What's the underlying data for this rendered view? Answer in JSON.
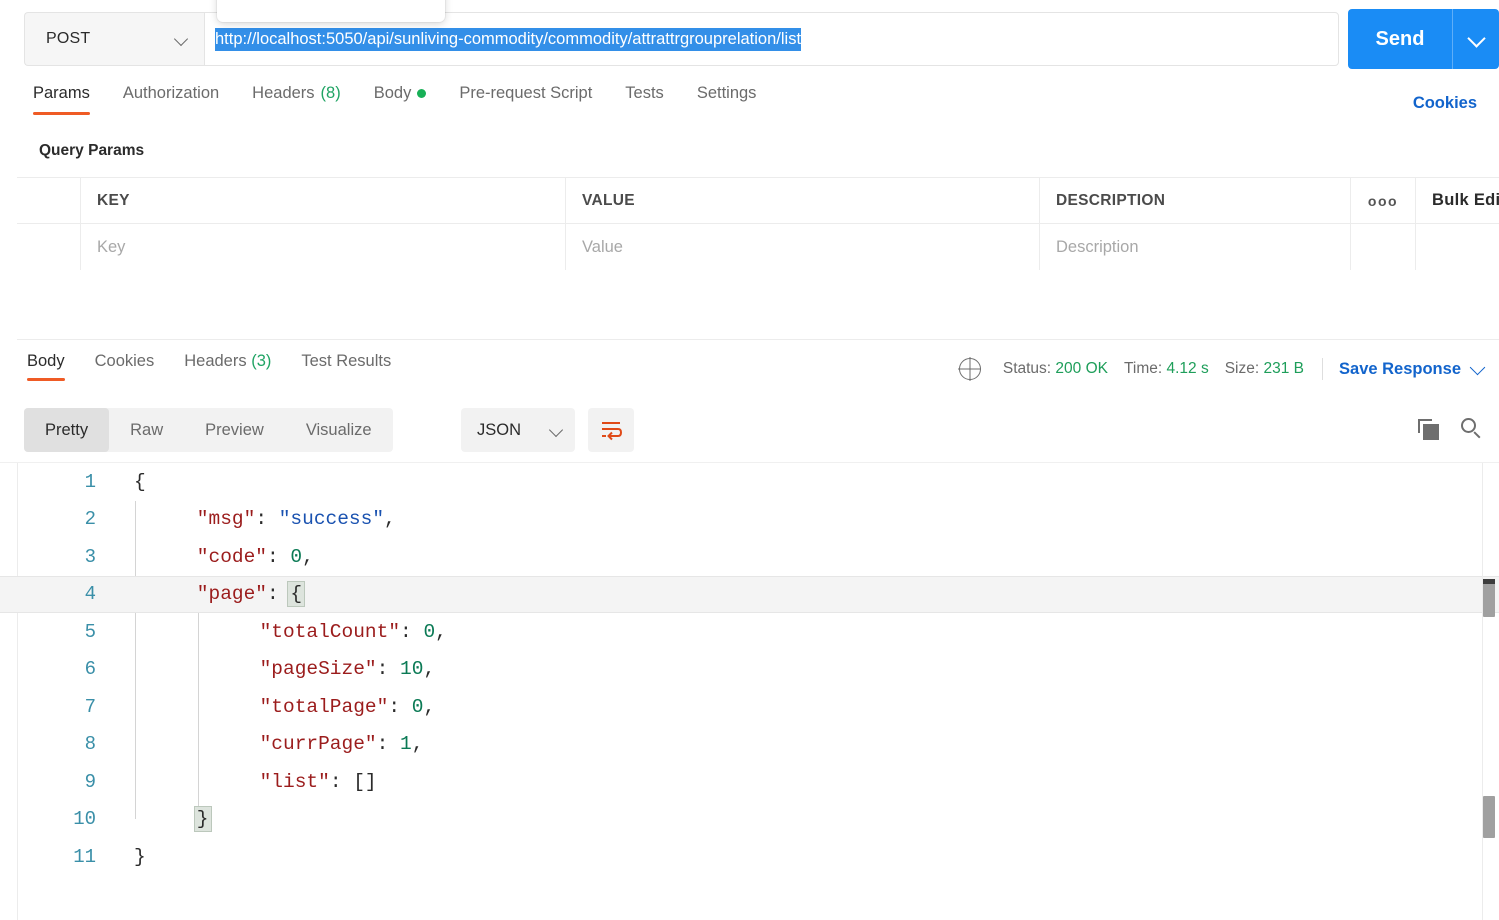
{
  "request": {
    "method": "POST",
    "url": "http://localhost:5050/api/sunliving-commodity/commodity/attrattrgrouprelation/list",
    "send_label": "Send",
    "tabs": [
      {
        "label": "Params",
        "count": "",
        "active": true
      },
      {
        "label": "Authorization",
        "count": "",
        "active": false
      },
      {
        "label": "Headers",
        "count": "(8)",
        "active": false
      },
      {
        "label": "Body",
        "count": "",
        "active": false,
        "dot": true
      },
      {
        "label": "Pre-request Script",
        "count": "",
        "active": false
      },
      {
        "label": "Tests",
        "count": "",
        "active": false
      },
      {
        "label": "Settings",
        "count": "",
        "active": false
      }
    ],
    "cookies_link": "Cookies"
  },
  "query_params": {
    "title": "Query Params",
    "headers": {
      "key": "KEY",
      "value": "VALUE",
      "description": "DESCRIPTION",
      "more": "ooo",
      "bulk_edit": "Bulk Edit"
    },
    "row_placeholders": {
      "key": "Key",
      "value": "Value",
      "description": "Description"
    }
  },
  "response": {
    "tabs": [
      {
        "label": "Body",
        "count": "",
        "active": true
      },
      {
        "label": "Cookies",
        "count": "",
        "active": false
      },
      {
        "label": "Headers",
        "count": "(3)",
        "active": false
      },
      {
        "label": "Test Results",
        "count": "",
        "active": false
      }
    ],
    "status": {
      "label": "Status:",
      "value": "200 OK"
    },
    "time": {
      "label": "Time:",
      "value": "4.12 s"
    },
    "size": {
      "label": "Size:",
      "value": "231 B"
    },
    "save_response": "Save Response",
    "viewer": {
      "modes": [
        {
          "label": "Pretty",
          "active": true
        },
        {
          "label": "Raw",
          "active": false
        },
        {
          "label": "Preview",
          "active": false
        },
        {
          "label": "Visualize",
          "active": false
        }
      ],
      "format": "JSON",
      "wrap_icon": "word-wrap-icon",
      "copy_icon": "copy-icon",
      "search_icon": "search-icon"
    },
    "body_lines": [
      {
        "n": "1",
        "tokens": [
          {
            "t": "{",
            "c": "brace"
          }
        ]
      },
      {
        "n": "2",
        "indent": 4,
        "tokens": [
          {
            "t": "\"msg\"",
            "c": "key"
          },
          {
            "t": ": ",
            "c": "punct"
          },
          {
            "t": "\"success\"",
            "c": "str"
          },
          {
            "t": ",",
            "c": "punct"
          }
        ]
      },
      {
        "n": "3",
        "indent": 4,
        "tokens": [
          {
            "t": "\"code\"",
            "c": "key"
          },
          {
            "t": ": ",
            "c": "punct"
          },
          {
            "t": "0",
            "c": "num"
          },
          {
            "t": ",",
            "c": "punct"
          }
        ]
      },
      {
        "n": "4",
        "indent": 4,
        "highlight": true,
        "tokens": [
          {
            "t": "\"page\"",
            "c": "key"
          },
          {
            "t": ": ",
            "c": "punct"
          },
          {
            "t": "{",
            "c": "brace",
            "match": true
          }
        ]
      },
      {
        "n": "5",
        "indent": 8,
        "tokens": [
          {
            "t": "\"totalCount\"",
            "c": "key"
          },
          {
            "t": ": ",
            "c": "punct"
          },
          {
            "t": "0",
            "c": "num"
          },
          {
            "t": ",",
            "c": "punct"
          }
        ]
      },
      {
        "n": "6",
        "indent": 8,
        "tokens": [
          {
            "t": "\"pageSize\"",
            "c": "key"
          },
          {
            "t": ": ",
            "c": "punct"
          },
          {
            "t": "10",
            "c": "num"
          },
          {
            "t": ",",
            "c": "punct"
          }
        ]
      },
      {
        "n": "7",
        "indent": 8,
        "tokens": [
          {
            "t": "\"totalPage\"",
            "c": "key"
          },
          {
            "t": ": ",
            "c": "punct"
          },
          {
            "t": "0",
            "c": "num"
          },
          {
            "t": ",",
            "c": "punct"
          }
        ]
      },
      {
        "n": "8",
        "indent": 8,
        "tokens": [
          {
            "t": "\"currPage\"",
            "c": "key"
          },
          {
            "t": ": ",
            "c": "punct"
          },
          {
            "t": "1",
            "c": "num"
          },
          {
            "t": ",",
            "c": "punct"
          }
        ]
      },
      {
        "n": "9",
        "indent": 8,
        "tokens": [
          {
            "t": "\"list\"",
            "c": "key"
          },
          {
            "t": ": ",
            "c": "punct"
          },
          {
            "t": "[]",
            "c": "brace"
          }
        ]
      },
      {
        "n": "10",
        "indent": 4,
        "tokens": [
          {
            "t": "}",
            "c": "brace",
            "match": true
          }
        ]
      },
      {
        "n": "11",
        "indent": 0,
        "tokens": [
          {
            "t": "}",
            "c": "brace"
          }
        ]
      }
    ]
  },
  "colors": {
    "accent_orange": "#ef5b25",
    "link_blue": "#1264cc",
    "send_blue": "#1a8cf5",
    "selection_blue": "#338fe8",
    "status_green": "#1e9e5a",
    "json_key": "#9b1c1c",
    "json_string": "#1a52b0",
    "json_number": "#0b7a55",
    "lineno": "#3a8fa8"
  }
}
